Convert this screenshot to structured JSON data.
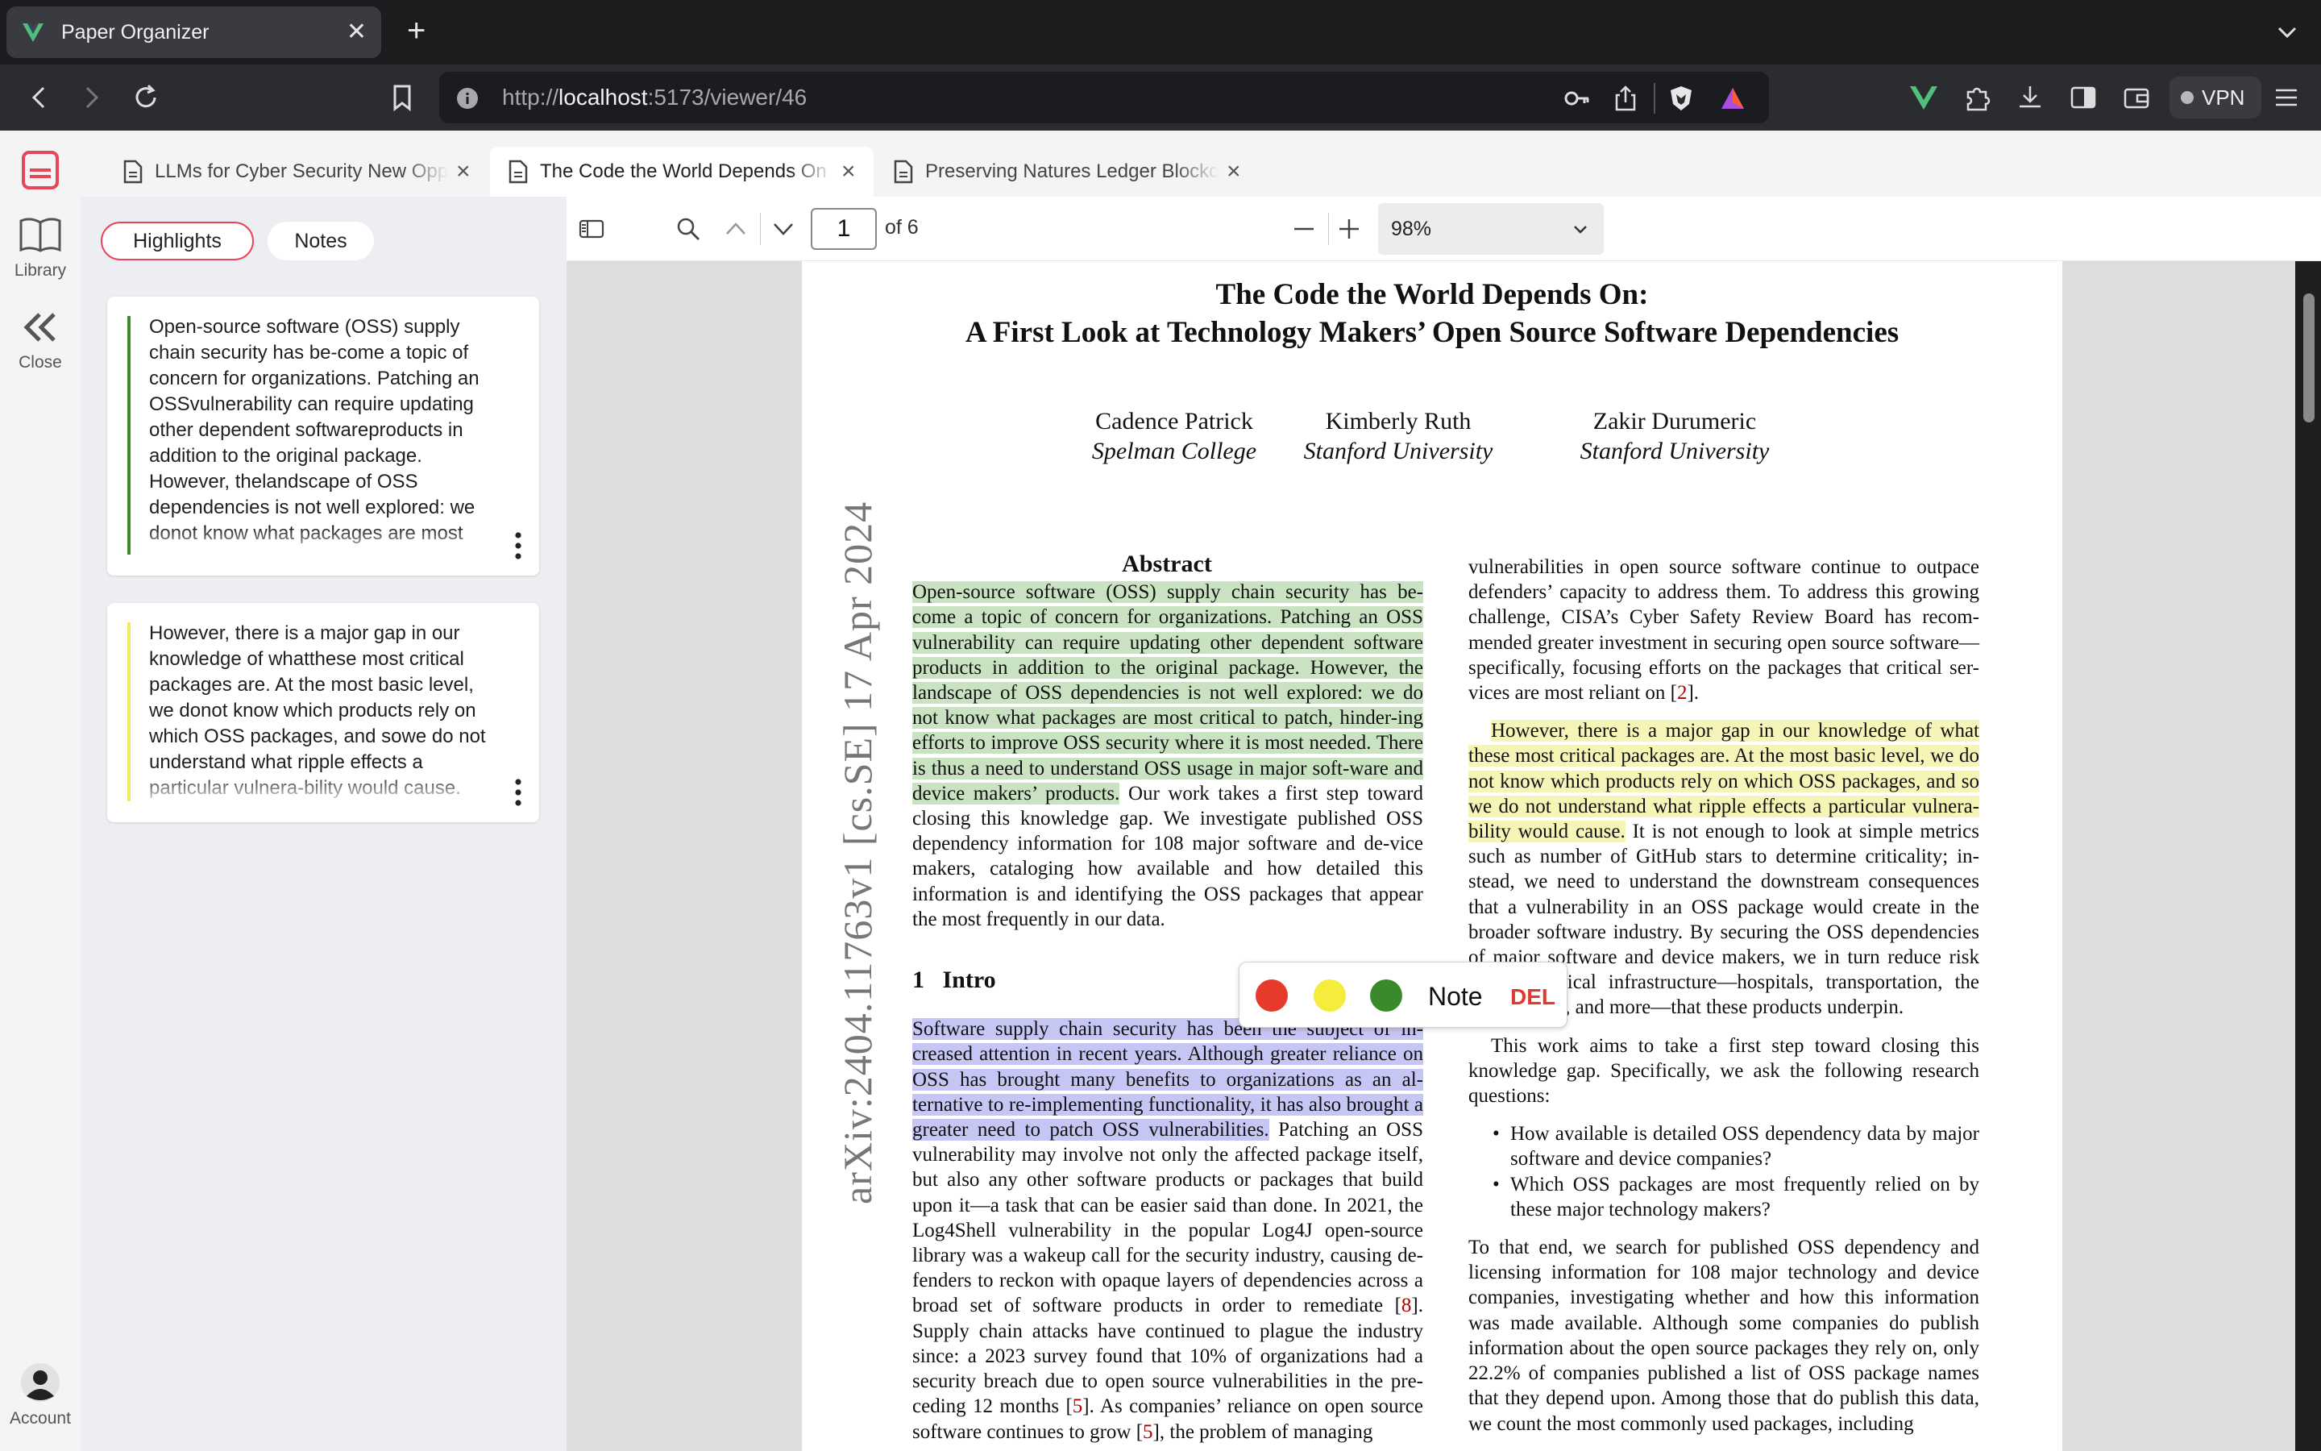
{
  "browser": {
    "tab_title": "Paper Organizer",
    "url_scheme": "http://",
    "url_host": "localhost",
    "url_path": ":5173/viewer/46",
    "vpn_label": "VPN",
    "brand_color": "#4fbf7a"
  },
  "rail": {
    "library_label": "Library",
    "close_label": "Close",
    "account_label": "Account",
    "logo_color": "#e8445a"
  },
  "doc_tabs": [
    {
      "label": "LLMs for Cyber Security New Opportunities"
    },
    {
      "label": "The Code the World Depends On"
    },
    {
      "label": "Preserving Natures Ledger Blockchain"
    }
  ],
  "sidebar": {
    "segment_highlights": "Highlights",
    "segment_notes": "Notes",
    "highlights": [
      {
        "text": "Open-source software (OSS) supply chain security has be-come a topic of concern for organizations. Patching an OSSvulnerability can require updating other dependent softwareproducts in addition to the original package. However, thelandscape of OSS dependencies is not well explored: we donot know what packages are most",
        "color": "#3b8a2c"
      },
      {
        "text": "However, there is a major gap in our knowledge of whatthese most critical packages are. At the most basic level, we donot know which products rely on which OSS packages, and sowe do not understand what ripple effects a particular vulnera-bility would cause.",
        "color": "#f2ea5e"
      }
    ]
  },
  "pdf_toolbar": {
    "page_number": "1",
    "page_total": "of 6",
    "zoom": "98%"
  },
  "paper": {
    "title_line1": "The Code the World Depends On:",
    "title_line2": "A First Look at Technology Makers’ Open Source Software Dependencies",
    "authors": [
      {
        "name": "Cadence Patrick",
        "affiliation": "Spelman College"
      },
      {
        "name": "Kimberly Ruth",
        "affiliation": "Stanford University"
      },
      {
        "name": "Zakir Durumeric",
        "affiliation": "Stanford University"
      }
    ],
    "arxiv_id": "arXiv:2404.11763v1  [cs.SE]  17 Apr 2024",
    "abstract_heading": "Abstract",
    "abstract_highlighted": "Open-source software (OSS) supply chain security has be-come a topic of concern for organizations. Patching an OSS vulnerability can require updating other dependent software products in addition to the original package. However, the landscape of OSS dependencies is not well explored: we do not know what packages are most critical to patch, hinder-ing efforts to improve OSS security where it is most needed. There is thus a need to understand OSS usage in major soft-ware and device makers’ products.",
    "abstract_rest": " Our work takes a first step toward closing this knowledge gap. We investigate published OSS dependency information for 108 major software and de-vice makers, cataloging how available and how detailed this information is and identifying the OSS packages that appear the most frequently in our data.",
    "section_number": "1",
    "section_partial": "Intro",
    "intro_highlighted": "Software supply chain security has been the subject of in-creased attention in recent years. Although greater reliance on OSS has brought many benefits to organizations as an al-ternative to re-implementing functionality, it has also brought a greater need to patch OSS vulnerabilities.",
    "intro_rest_a": " Patching an OSS vulnerability may involve not only the affected package itself, but also any other software products or packages that build upon it—a task that can be easier said than done. In 2021, the Log4Shell vulnerability in the popular Log4J open-source library was a wakeup call for the security industry, causing de-fenders to reckon with opaque layers of dependencies across a broad set of software products in order to remediate [",
    "cite_8": "8",
    "intro_rest_b": "]. Supply chain attacks have continued to plague the industry since: a 2023 survey found that 10% of organizations had a security breach due to open source vulnerabilities in the pre-ceding 12 months [",
    "cite_5": "5",
    "intro_rest_c": "]. As companies’ reliance on open source software continues to grow [",
    "cite_5b": "5",
    "intro_rest_d": "], the problem of managing",
    "right_p1_a": "vulnerabilities in open source software continue to outpace defenders’ capacity to address them. To address this growing challenge, CISA’s Cyber Safety Review Board has recom-mended greater investment in securing open source software—specifically, focusing efforts on the packages that critical ser-vices are most reliant on [",
    "cite_2": "2",
    "right_p1_b": "].",
    "right_p2_highlighted": "However, there is a major gap in our knowledge of what these most critical packages are. At the most basic level, we do not know which products rely on which OSS packages, and so we do not understand what ripple effects a particular vulnera-bility would cause.",
    "right_p2_rest": " It is not enough to look at simple metrics such as number of GitHub stars to determine criticality; in-stead, we need to understand the downstream consequences that a vulnerability in an OSS package would create in the broader software industry. By securing the OSS dependencies of major software and device makers, we in turn reduce risk for the critical infrastructure—hospitals, transportation, the electric grid, and more—that these products underpin.",
    "right_p3": "This work aims to take a first step toward closing this knowledge gap. Specifically, we ask the following research questions:",
    "bullet1": "How available is detailed OSS dependency data by major software and device companies?",
    "bullet2": "Which OSS packages are most frequently relied on by these major technology makers?",
    "right_p4": "To that end, we search for published OSS dependency and licensing information for 108 major technology and device companies, investigating whether and how this information was made available. Although some companies do publish information about the open source packages they rely on, only 22.2% of companies published a list of OSS package names that they depend upon. Among those that do publish this data, we count the most commonly used packages, including"
  },
  "picker": {
    "note_label": "Note",
    "del_label": "DEL",
    "colors": [
      "#e63a2b",
      "#f5ec3c",
      "#3a8a2c"
    ]
  }
}
